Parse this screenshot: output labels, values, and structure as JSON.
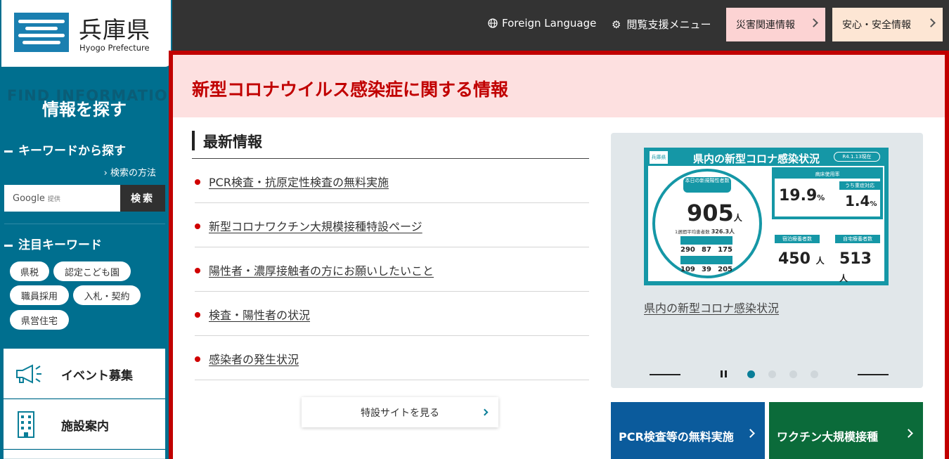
{
  "site": {
    "name_jp": "兵庫県",
    "name_en": "Hyogo Prefecture"
  },
  "header": {
    "foreign_language": "Foreign Language",
    "accessibility_menu": "閲覧支援メニュー",
    "disaster_info": "災害関連情報",
    "safety_info": "安心・安全情報"
  },
  "sidebar": {
    "find_bg": "FIND INFORMATION",
    "find_title": "情報を探す",
    "keyword_title": "キーワードから探す",
    "search_method": "検索の方法",
    "search_placeholder_brand": "Google",
    "search_placeholder_sub": "提供",
    "search_button": "検索",
    "featured_title": "注目キーワード",
    "tags": [
      "県税",
      "認定こども園",
      "職員採用",
      "入札・契約",
      "県営住宅"
    ],
    "menu": [
      "イベント募集",
      "施設案内"
    ]
  },
  "banner": {
    "title": "新型コロナウイルス感染症に関する情報"
  },
  "news": {
    "heading": "最新情報",
    "items": [
      "PCR検査・抗原定性検査の無料実施",
      "新型コロナワクチン大規模接種特設ページ",
      "陽性者・濃厚接触者の方にお願いしたいこと",
      "検査・陽性者の状況",
      "感染者の発生状況"
    ],
    "special_site": "特設サイトを見る"
  },
  "slider": {
    "image_title": "県内の新型コロナ感染状況",
    "image_logo": "兵庫県",
    "image_date": "R4.1.13現在",
    "today_label": "本日の新規陽性者数",
    "today_count": "905",
    "unit_person": "人",
    "weekly_label": "1週間平均患者数",
    "weekly_count": "326.3人",
    "bed_label": "病床使用率",
    "bed_rate": "19.9",
    "severe_rate": "1.4",
    "percent": "%",
    "severe_label": "うち重症対応",
    "hospital_label": "宿泊療養者数",
    "hospital_count": "450",
    "home_label": "自宅療養者数",
    "home_count": "513",
    "grid_rows": [
      [
        "290",
        "87",
        "175"
      ],
      [
        "109",
        "39",
        "205"
      ]
    ],
    "caption": "県内の新型コロナ感染状況",
    "dots": 4,
    "active_dot": 0
  },
  "bottom_buttons": {
    "pcr": "PCR検査等の無料実施",
    "vaccine": "ワクチン大規模接種"
  },
  "colors": {
    "teal": "#006f8f",
    "red": "#c10000",
    "pink": "#fde0e0",
    "blue_btn": "#0b5b9c",
    "green_btn": "#0b6b3a"
  }
}
